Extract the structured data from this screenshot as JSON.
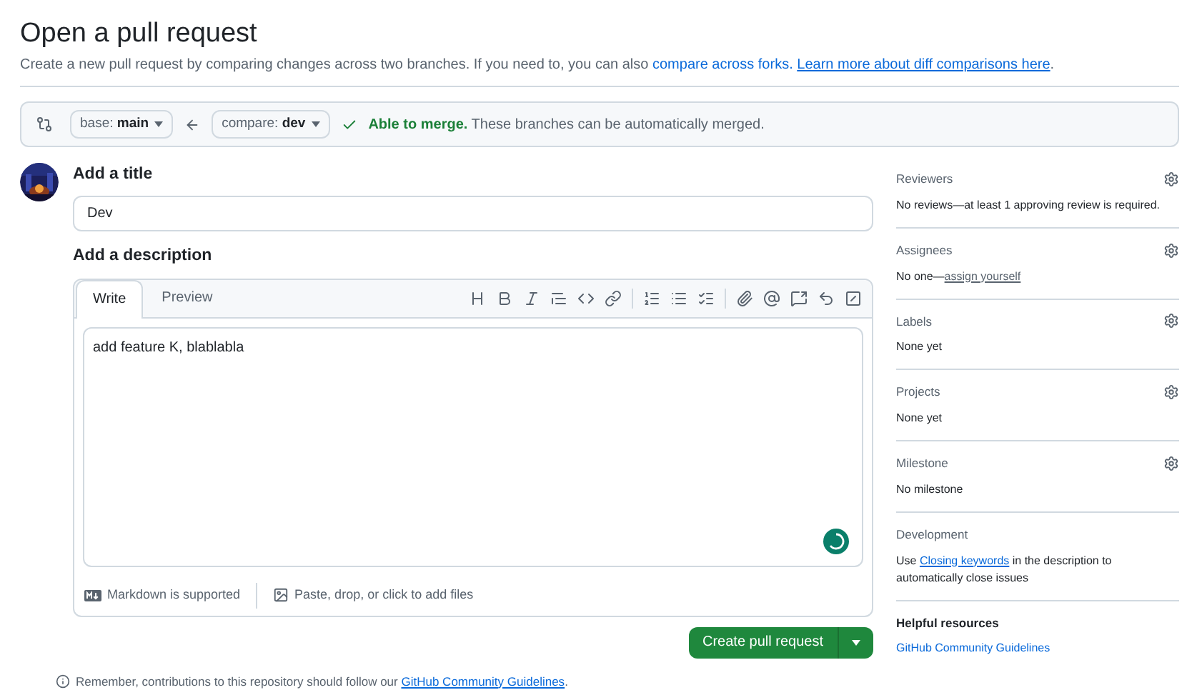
{
  "header": {
    "title": "Open a pull request",
    "description": "Create a new pull request by comparing changes across two branches. If you need to, you can also ",
    "forks_link": "compare across forks.",
    "learn_link": "Learn more about diff comparisons here",
    "period": "."
  },
  "compare_bar": {
    "base": {
      "label": "base:",
      "branch": "main"
    },
    "compare": {
      "label": "compare:",
      "branch": "dev"
    },
    "merge_status": {
      "status": "Able to merge.",
      "detail": "These branches can be automatically merged."
    }
  },
  "title_field": {
    "label": "Add a title",
    "value": "Dev"
  },
  "description": {
    "label": "Add a description",
    "tabs": [
      {
        "label": "Write",
        "selected": true
      },
      {
        "label": "Preview",
        "selected": false
      }
    ],
    "value": "add feature K, blablabla",
    "footer": {
      "markdown": "Markdown is supported",
      "attach": "Paste, drop, or click to add files"
    }
  },
  "create_button": {
    "label": "Create pull request"
  },
  "footnote": {
    "text": "Remember, contributions to this repository should follow our ",
    "link": "GitHub Community Guidelines",
    "period": "."
  },
  "sidebar": [
    {
      "kind": "setting",
      "heading": "Reviewers",
      "body": [
        {
          "text": "No reviews—at least 1 approving review is required.",
          "link": false
        }
      ]
    },
    {
      "kind": "setting",
      "heading": "Assignees",
      "body": [
        {
          "text": "No one—",
          "link": false
        },
        {
          "text": "assign yourself",
          "link": true
        }
      ]
    },
    {
      "kind": "setting",
      "heading": "Labels",
      "body": [
        {
          "text": "None yet",
          "link": false
        }
      ]
    },
    {
      "kind": "setting",
      "heading": "Projects",
      "body": [
        {
          "text": "None yet",
          "link": false
        }
      ]
    },
    {
      "kind": "setting",
      "heading": "Milestone",
      "body": [
        {
          "text": "No milestone",
          "link": false
        }
      ]
    },
    {
      "kind": "info",
      "heading": "Development",
      "body": [
        {
          "text": "Use ",
          "link": false
        },
        {
          "text": "Closing keywords",
          "link": true
        },
        {
          "text": " in the description to automatically close issues",
          "link": false
        }
      ]
    },
    {
      "kind": "resources",
      "heading": "Helpful resources",
      "body": [
        {
          "text": "GitHub Community Guidelines",
          "link": true
        }
      ]
    }
  ]
}
